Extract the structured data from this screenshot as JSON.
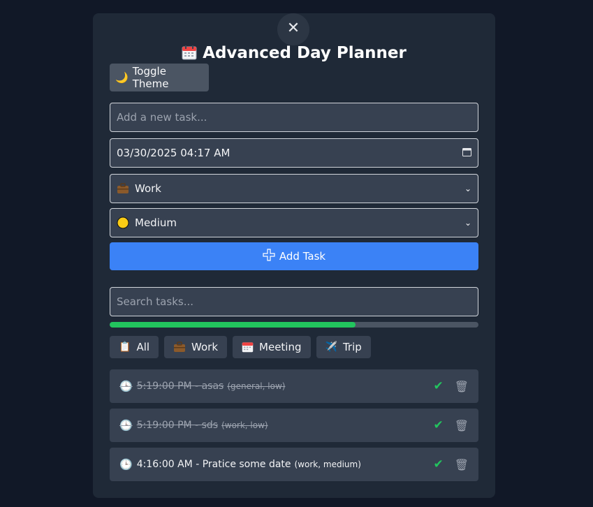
{
  "app": {
    "title": "Advanced Day Planner",
    "close_symbol": "✕"
  },
  "theme_button": {
    "icon": "moon-icon",
    "label": "Toggle Theme"
  },
  "task_input": {
    "value": "",
    "placeholder": "Add a new task..."
  },
  "datetime_input": {
    "value": "03/30/2025 04:17 AM"
  },
  "category_select": {
    "icon": "briefcase-icon",
    "selected": "Work"
  },
  "priority_select": {
    "icon": "yellow-circle-icon",
    "selected": "Medium",
    "color": "#facc15"
  },
  "add_button": {
    "icon": "plus-icon",
    "label": "Add Task"
  },
  "search_input": {
    "value": "",
    "placeholder": "Search tasks..."
  },
  "progress": {
    "fraction": 0.667,
    "color": "#22c55e"
  },
  "filters": [
    {
      "icon": "clipboard-icon",
      "label": "All"
    },
    {
      "icon": "briefcase-icon",
      "label": "Work"
    },
    {
      "icon": "calendar-icon",
      "label": "Meeting"
    },
    {
      "icon": "airplane-icon",
      "label": "Trip"
    }
  ],
  "tasks": [
    {
      "time": "5:19:00 PM",
      "title": "asas",
      "meta": "(general, low)",
      "completed": true
    },
    {
      "time": "5:19:00 PM",
      "title": "sds",
      "meta": "(work, low)",
      "completed": true
    },
    {
      "time": "4:16:00 AM",
      "title": "Pratice some date",
      "meta": "(work, medium)",
      "completed": false
    }
  ],
  "colors": {
    "background": "#111827",
    "card": "#1f2937",
    "accent": "#3b82f6",
    "success": "#22c55e"
  }
}
